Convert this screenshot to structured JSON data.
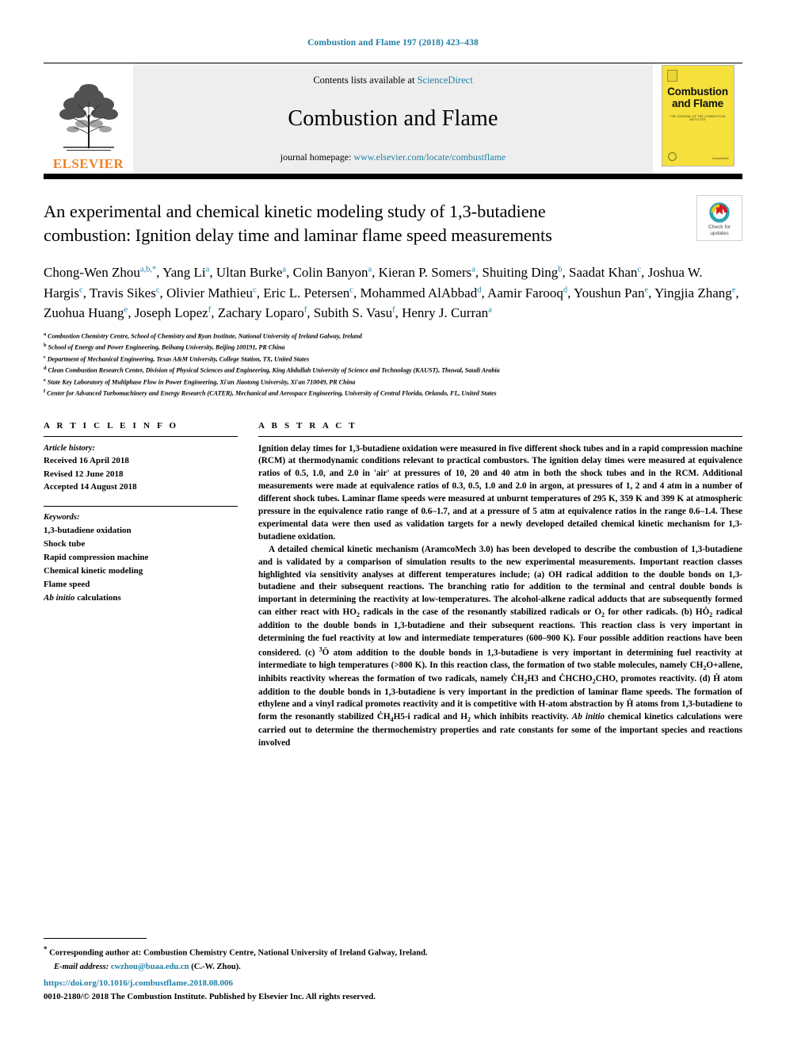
{
  "running_head": "Combustion and Flame 197 (2018) 423–438",
  "masthead": {
    "publisher_word": "ELSEVIER",
    "contents_prefix": "Contents lists available at ",
    "contents_link": "ScienceDirect",
    "journal_name": "Combustion and Flame",
    "homepage_prefix": "journal homepage: ",
    "homepage_link": "www.elsevier.com/locate/combustflame",
    "cover": {
      "title_line1": "Combustion",
      "title_line2": "and Flame",
      "subtitle": "THE JOURNAL OF THE COMBUSTION INSTITUTE",
      "badge_text": "THE COMBUSTION INSTITUTE",
      "footer_text": "available online at\nScienceDirect"
    }
  },
  "crossmark": {
    "label_line1": "Check for",
    "label_line2": "updates",
    "ring_colors": [
      "#cf2027",
      "#f5c518",
      "#2ba3b5"
    ]
  },
  "title": "An experimental and chemical kinetic modeling study of 1,3-butadiene combustion: Ignition delay time and laminar flame speed measurements",
  "authors": [
    {
      "name": "Chong-Wen Zhou",
      "marks": "a,b,*"
    },
    {
      "name": "Yang Li",
      "marks": "a"
    },
    {
      "name": "Ultan Burke",
      "marks": "a"
    },
    {
      "name": "Colin Banyon",
      "marks": "a"
    },
    {
      "name": "Kieran P. Somers",
      "marks": "a"
    },
    {
      "name": "Shuiting Ding",
      "marks": "b"
    },
    {
      "name": "Saadat Khan",
      "marks": "c"
    },
    {
      "name": "Joshua W. Hargis",
      "marks": "c"
    },
    {
      "name": "Travis Sikes",
      "marks": "c"
    },
    {
      "name": "Olivier Mathieu",
      "marks": "c"
    },
    {
      "name": "Eric L. Petersen",
      "marks": "c"
    },
    {
      "name": "Mohammed AlAbbad",
      "marks": "d"
    },
    {
      "name": "Aamir Farooq",
      "marks": "d"
    },
    {
      "name": "Youshun Pan",
      "marks": "e"
    },
    {
      "name": "Yingjia Zhang",
      "marks": "e"
    },
    {
      "name": "Zuohua Huang",
      "marks": "e"
    },
    {
      "name": "Joseph Lopez",
      "marks": "f"
    },
    {
      "name": "Zachary Loparo",
      "marks": "f"
    },
    {
      "name": "Subith S. Vasu",
      "marks": "f"
    },
    {
      "name": "Henry J. Curran",
      "marks": "a"
    }
  ],
  "affiliations": [
    {
      "mark": "a",
      "text": "Combustion Chemistry Centre, School of Chemistry and Ryan Institute, National University of Ireland Galway, Ireland"
    },
    {
      "mark": "b",
      "text": "School of Energy and Power Engineering, Beihang University, Beijing 100191, PR China"
    },
    {
      "mark": "c",
      "text": "Department of Mechanical Engineering, Texas A&M University, College Station, TX, United States"
    },
    {
      "mark": "d",
      "text": "Clean Combustion Research Center, Division of Physical Sciences and Engineering, King Abdullah University of Science and Technology (KAUST), Thuwal, Saudi Arabia"
    },
    {
      "mark": "e",
      "text": "State Key Laboratory of Multiphase Flow in Power Engineering, Xi'an Jiaotong University, Xi'an 710049, PR China"
    },
    {
      "mark": "f",
      "text": "Center for Advanced Turbomachinery and Energy Research (CATER), Mechanical and Aerospace Engineering, University of Central Florida, Orlando, FL, United States"
    }
  ],
  "article_info": {
    "heading": "A R T I C L E   I N F O",
    "history_label": "Article history:",
    "history": [
      "Received 16 April 2018",
      "Revised 12 June 2018",
      "Accepted 14 August 2018"
    ],
    "keywords_label": "Keywords:",
    "keywords": [
      "1,3-butadiene oxidation",
      "Shock tube",
      "Rapid compression machine",
      "Chemical kinetic modeling",
      "Flame speed",
      "Ab initio calculations"
    ],
    "keyword_italic_last": "Ab initio"
  },
  "abstract": {
    "heading": "A B S T R A C T",
    "paragraph1_parts": [
      {
        "t": "Ignition delay times for 1,3-butadiene oxidation were measured in five different shock tubes and in a rapid compression machine (RCM) at thermodynamic conditions relevant to practical combustors. The ignition delay times were measured at equivalence ratios of 0.5, 1.0, and 2.0 in 'air' at pressures of 10, 20 and 40 atm in both the shock tubes and in the RCM. Additional measurements were made at equivalence ratios of 0.3, 0.5, 1.0 and 2.0 in argon, at pressures of 1, 2 and 4 atm in a number of different shock tubes. Laminar flame speeds were measured at unburnt temperatures of 295 K, 359 K and 399 K at atmospheric pressure in the equivalence ratio range of 0.6–1.7, and at a pressure of 5 atm at equivalence ratios in the range 0.6–1.4. These experimental data were then used as validation targets for a newly developed detailed chemical kinetic mechanism for 1,3-butadiene oxidation."
      }
    ],
    "paragraph2_parts": [
      {
        "t": "A detailed chemical kinetic mechanism (AramcoMech 3.0) has been developed to describe the combustion of 1,3-butadiene and is validated by a comparison of simulation results to the new experimental measurements. Important reaction classes highlighted via sensitivity analyses at different temperatures include; (a) "
      },
      {
        "t": "OH",
        "dot": true
      },
      {
        "t": " radical addition to the double bonds on 1,3-butadiene and their subsequent reactions. The branching ratio for addition to the terminal and central double bonds is important in determining the reactivity at low-temperatures. The alcohol-alkene radical adducts that are subsequently formed can either react with H"
      },
      {
        "t": "O",
        "sub": "2"
      },
      {
        "t": " radicals in the case of the resonantly stabilized radicals or O"
      },
      {
        "t": "",
        "sub": "2"
      },
      {
        "t": " for other radicals. (b) H"
      },
      {
        "t": "Ȯ",
        "sub": "2"
      },
      {
        "t": " radical addition to the double bonds in 1,3-butadiene and their subsequent reactions. This reaction class is very important in determining the fuel reactivity at low and intermediate temperatures (600–900 K). Four possible addition reactions have been considered. (c) "
      },
      {
        "t": "3Ö",
        "sup": "3"
      },
      {
        "t": " atom addition to the double bonds in 1,3-butadiene is very important in determining fuel reactivity at intermediate to high temperatures (>800 K). In this reaction class, the formation of two stable molecules, namely CH"
      },
      {
        "t": "2",
        "sub": "2"
      },
      {
        "t": "O+allene, inhibits reactivity whereas the formation of two radicals, namely Ċ"
      },
      {
        "t": "2H3",
        "sub": "2"
      },
      {
        "t": " and ĊH"
      },
      {
        "t": "2CHO",
        "sub": "2"
      },
      {
        "t": ", promotes reactivity. (d) Ḣ atom addition to the double bonds in 1,3-butadiene is very important in the prediction of laminar flame speeds. The formation of ethylene and a vinyl radical promotes reactivity and it is competitive with H-atom abstraction by Ḣ atoms from 1,3-butadiene to form the resonantly stabilized Ċ"
      },
      {
        "t": "4H5",
        "sub": "4"
      },
      {
        "t": "-i radical and H"
      },
      {
        "t": "2",
        "sub": "2"
      },
      {
        "t": " which inhibits reactivity. "
      },
      {
        "t": "Ab initio",
        "italic": true
      },
      {
        "t": " chemical kinetics calculations were carried out to determine the thermochemistry properties and rate constants for some of the important species and reactions involved"
      }
    ],
    "paragraph1": "Ignition delay times for 1,3-butadiene oxidation were measured in five different shock tubes and in a rapid compression machine (RCM) at thermodynamic conditions relevant to practical combustors. The ignition delay times were measured at equivalence ratios of 0.5, 1.0, and 2.0 in 'air' at pressures of 10, 20 and 40 atm in both the shock tubes and in the RCM. Additional measurements were made at equivalence ratios of 0.3, 0.5, 1.0 and 2.0 in argon, at pressures of 1, 2 and 4 atm in a number of different shock tubes. Laminar flame speeds were measured at unburnt temperatures of 295 K, 359 K and 399 K at atmospheric pressure in the equivalence ratio range of 0.6–1.7, and at a pressure of 5 atm at equivalence ratios in the range 0.6–1.4. These experimental data were then used as validation targets for a newly developed detailed chemical kinetic mechanism for 1,3-butadiene oxidation."
  },
  "footer": {
    "corresponding_star": "*",
    "corresponding_text": "Corresponding author at: Combustion Chemistry Centre, National University of Ireland Galway, Ireland.",
    "email_label": "E-mail address:",
    "email": "cwzhou@buaa.edu.cn",
    "email_suffix": "(C.-W. Zhou).",
    "doi": "https://doi.org/10.1016/j.combustflame.2018.08.006",
    "copyright": "0010-2180/© 2018 The Combustion Institute. Published by Elsevier Inc. All rights reserved."
  }
}
